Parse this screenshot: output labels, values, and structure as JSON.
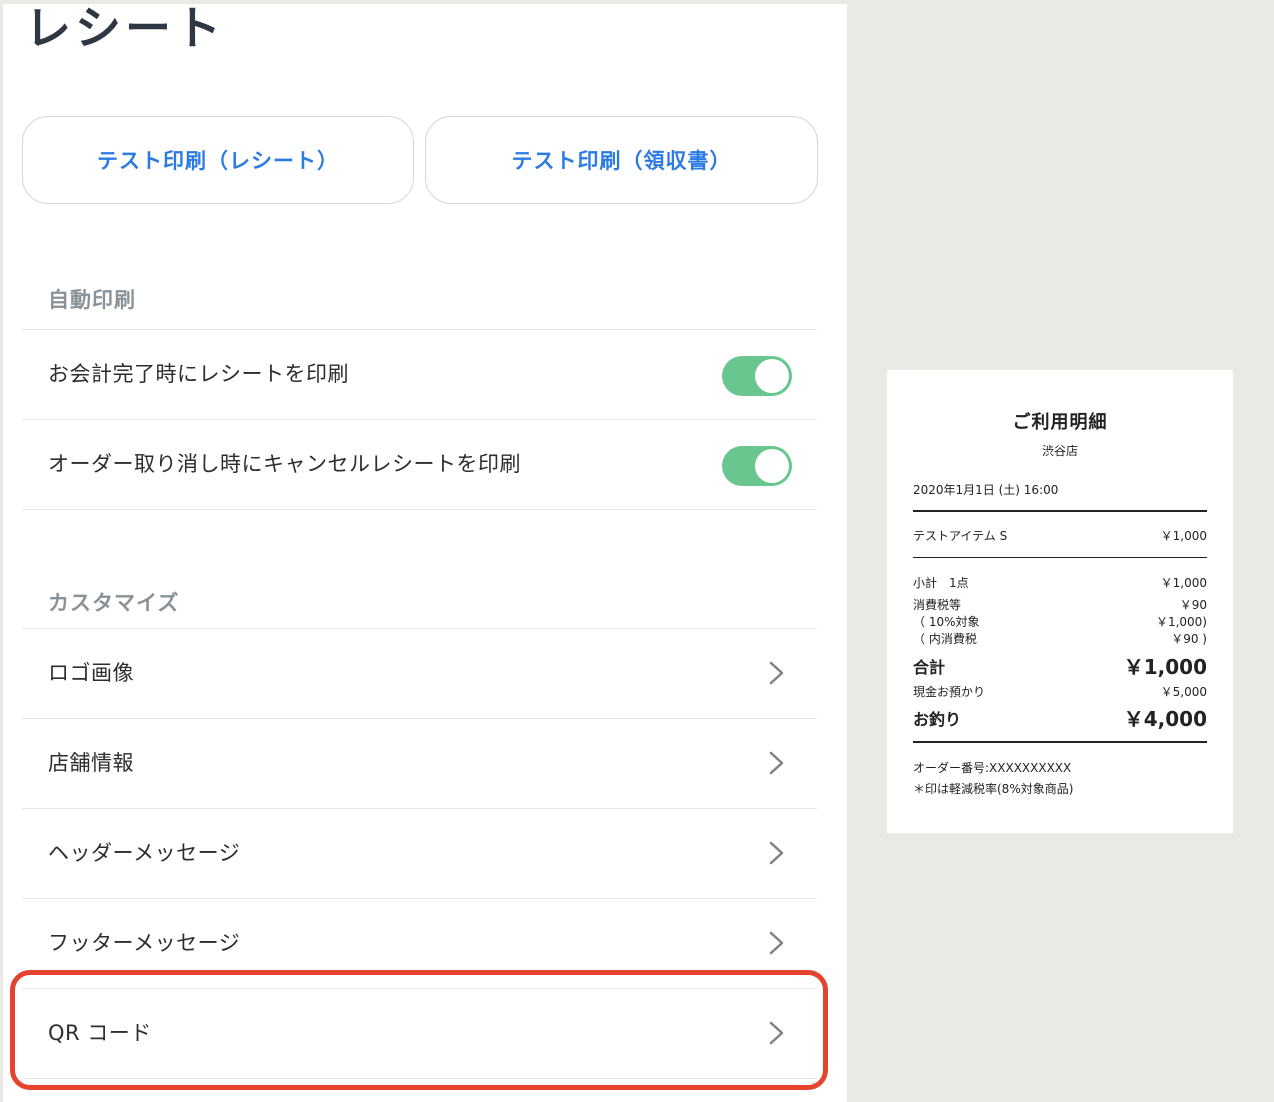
{
  "page": {
    "title": "レシート"
  },
  "buttons": {
    "test_receipt": "テスト印刷（レシート）",
    "test_invoice": "テスト印刷（領収書）"
  },
  "auto_print": {
    "header": "自動印刷",
    "items": [
      {
        "label": "お会計完了時にレシートを印刷",
        "enabled": true
      },
      {
        "label": "オーダー取り消し時にキャンセルレシートを印刷",
        "enabled": true
      }
    ]
  },
  "customize": {
    "header": "カスタマイズ",
    "items": [
      {
        "label": "ロゴ画像"
      },
      {
        "label": "店舗情報"
      },
      {
        "label": "ヘッダーメッセージ"
      },
      {
        "label": "フッターメッセージ"
      },
      {
        "label": "QR コード"
      }
    ]
  },
  "colors": {
    "accent_blue": "#2c7be5",
    "toggle_on": "#68c68e",
    "highlight": "#e5432e"
  },
  "receipt": {
    "title": "ご利用明細",
    "store": "渋谷店",
    "datetime": "2020年1月1日 (土) 16:00",
    "item_name": "テストアイテム S",
    "item_price": "￥1,000",
    "subtotal_label": "小計　1点",
    "subtotal": "￥1,000",
    "tax_label": "消費税等",
    "tax": "￥90",
    "tax_target_label": "（ 10%対象",
    "tax_target": "￥1,000)",
    "tax_inner_label": "（ 内消費税",
    "tax_inner": "￥90 )",
    "total_label": "合計",
    "total": "￥1,000",
    "cash_label": "現金お預かり",
    "cash": "￥5,000",
    "change_label": "お釣り",
    "change": "￥4,000",
    "order_no": "オーダー番号:XXXXXXXXXX",
    "note": "＊印は軽減税率(8%対象商品)"
  }
}
